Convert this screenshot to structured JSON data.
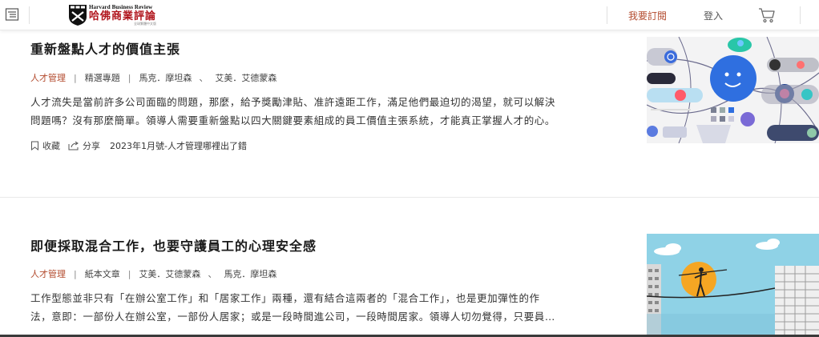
{
  "header": {
    "logo_en": "Harvard Business Review",
    "logo_zh": "哈佛商業評論",
    "logo_sub": "全球繁體中文版",
    "subscribe_label": "我要訂閱",
    "login_label": "登入"
  },
  "articles": [
    {
      "title": "重新盤點人才的價值主張",
      "category": "人才管理",
      "tag": "精選專題",
      "authors": [
        "馬克．摩坦森",
        "艾美．艾德蒙森"
      ],
      "author_sep": "、",
      "summary_lines": [
        "人才流失是當前許多公司面臨的問題，那麼，給予獎勵津貼、准許遠距工作，滿足他們最迫切的渴望，就可以解決",
        "問題嗎？沒有那麼簡單。領導人需要重新盤點以四大關鍵要素組成的員工價值主張系統，才能真正掌握人才的心。"
      ],
      "save_label": "收藏",
      "share_label": "分享",
      "issue": "2023年1月號-人才管理哪裡出了錯"
    },
    {
      "title": "即便採取混合工作，也要守護員工的心理安全感",
      "category": "人才管理",
      "tag": "紙本文章",
      "authors": [
        "艾美．艾德蒙森",
        "馬克．摩坦森"
      ],
      "author_sep": "、",
      "summary_lines": [
        "工作型態並非只有「在辦公室工作」和「居家工作」兩種，還有結合這兩者的「混合工作」，也是更加彈性的作",
        "法，意即：一部份人在辦公室，一部份人居家；或是一段時間進公司，一段時間居家。領導人切勿覺得，只要員…"
      ]
    }
  ],
  "colors": {
    "accent": "#b34b2e",
    "brand_red": "#b0141c",
    "text": "#333333",
    "separator": "#eaeaea"
  },
  "icons": {
    "menu": "menu-icon",
    "logo": "hbr-shield-logo",
    "cart": "cart-icon",
    "bookmark": "bookmark-icon",
    "share": "share-icon"
  }
}
